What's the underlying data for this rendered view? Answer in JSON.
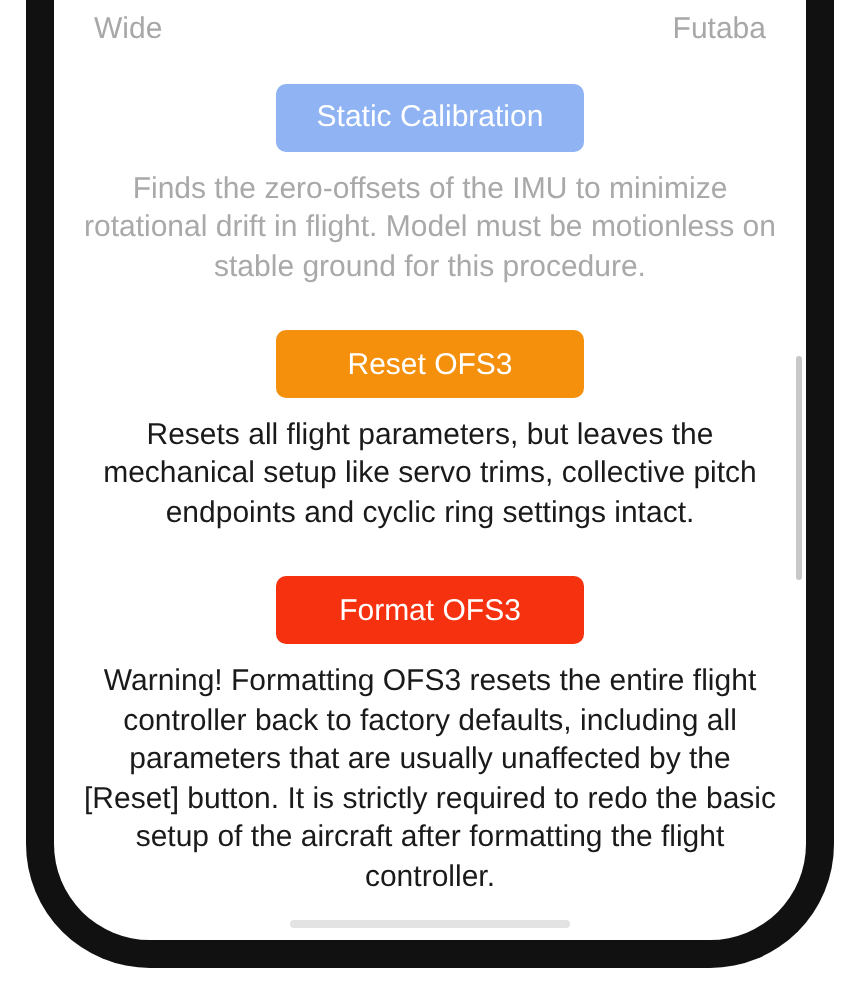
{
  "header": {
    "left": "Wide",
    "right": "Futaba"
  },
  "actions": [
    {
      "kind": "primary",
      "label": "Static Calibration",
      "disabled": true,
      "description": "Finds the zero-offsets of the IMU to minimize rotational drift in flight. Model must be motionless on stable ground for this procedure."
    },
    {
      "kind": "warning",
      "label": "Reset OFS3",
      "disabled": false,
      "description": "Resets all flight parameters, but leaves the mechanical setup like servo trims, collective pitch endpoints and cyclic ring settings intact."
    },
    {
      "kind": "danger",
      "label": "Format OFS3",
      "disabled": false,
      "description": "Warning! Formatting OFS3 resets the entire flight controller back to factory defaults, including all parameters that are usually unaffected by the [Reset] button. It is strictly required to redo the basic setup of the aircraft after formatting the flight controller."
    }
  ]
}
